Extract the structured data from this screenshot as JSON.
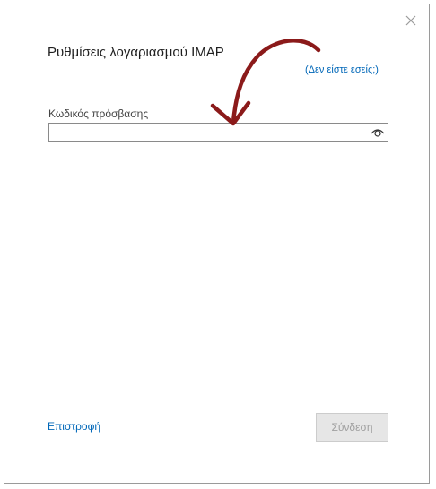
{
  "dialog": {
    "title": "Ρυθμίσεις λογαριασμού IMAP",
    "not_you_link": "(Δεν είστε εσείς;)",
    "close_icon": "close-icon"
  },
  "password": {
    "label": "Κωδικός πρόσβασης",
    "value": "",
    "placeholder": "",
    "reveal_icon": "eye-icon"
  },
  "footer": {
    "back_label": "Επιστροφή",
    "signin_label": "Σύνδεση",
    "signin_enabled": false
  },
  "annotation": {
    "color": "#8b1a1a",
    "shape": "curved-arrow"
  },
  "colors": {
    "link": "#0067b8",
    "disabled_button_bg": "#e6e6e6",
    "disabled_button_text": "#a0a0a0"
  }
}
